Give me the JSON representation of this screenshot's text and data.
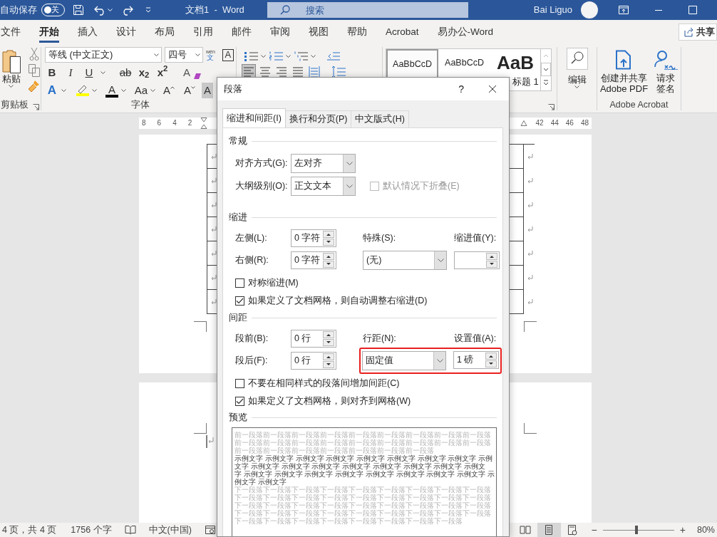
{
  "title_bar": {
    "autosave_label": "自动保存",
    "autosave_toggle": {
      "label": "关",
      "on": false
    },
    "document_title": "文档1  -  Word",
    "search": {
      "placeholder": "搜索"
    },
    "user_name": "Bai Liguo"
  },
  "ribbon_tabs": [
    {
      "label": "文件",
      "selected": false
    },
    {
      "label": "开始",
      "selected": true
    },
    {
      "label": "插入",
      "selected": false
    },
    {
      "label": "设计",
      "selected": false
    },
    {
      "label": "布局",
      "selected": false
    },
    {
      "label": "引用",
      "selected": false
    },
    {
      "label": "邮件",
      "selected": false
    },
    {
      "label": "审阅",
      "selected": false
    },
    {
      "label": "视图",
      "selected": false
    },
    {
      "label": "帮助",
      "selected": false
    },
    {
      "label": "Acrobat",
      "selected": false
    },
    {
      "label": "易办公-Word",
      "selected": false
    }
  ],
  "share_button": {
    "label": "共享"
  },
  "clipboard": {
    "paste_label": "粘贴",
    "group_label": "剪贴板"
  },
  "font": {
    "font_name": "等线 (中文正文)",
    "font_size": "四号",
    "phonetic": {
      "top": "wén",
      "bottom": "文"
    },
    "border_label": "A",
    "row2": [
      {
        "kind": "bold",
        "label": "B"
      },
      {
        "kind": "italic",
        "label": "I"
      },
      {
        "kind": "underline",
        "label": "U"
      },
      {
        "kind": "strike",
        "label": "ab"
      },
      {
        "kind": "subscript",
        "label": "x$_{2}$"
      },
      {
        "kind": "superscript",
        "label": "x$^{2}$"
      },
      {
        "kind": "clear",
        "label": "A"
      }
    ],
    "row3": [
      {
        "kind": "effects",
        "label": "A"
      },
      {
        "kind": "highlight",
        "color": "#ffff00"
      },
      {
        "kind": "color",
        "label": "A",
        "color": "#000000"
      },
      {
        "kind": "case",
        "label": "Aa"
      },
      {
        "kind": "grow",
        "label": "A"
      },
      {
        "kind": "shrink",
        "label": "A"
      },
      {
        "kind": "shading",
        "label": "A"
      }
    ],
    "group_label": "字体"
  },
  "paragraph": {
    "alignment": [
      {
        "kind": "left",
        "selected": true
      },
      {
        "kind": "center",
        "selected": false
      },
      {
        "kind": "right",
        "selected": false
      },
      {
        "kind": "justify",
        "selected": false
      },
      {
        "kind": "distributed",
        "selected": false
      }
    ]
  },
  "styles": [
    {
      "kind": "normal",
      "preview": "AaBbCcD",
      "selected": true
    },
    {
      "kind": "nospacing",
      "preview": "AaBbCcD",
      "selected": false
    },
    {
      "kind": "heading",
      "preview": "AaB",
      "label": "标题 1",
      "selected": false
    }
  ],
  "editing": {
    "label": "编辑"
  },
  "acrobat": {
    "buttons": [
      {
        "kind": "pdf",
        "lines": [
          "创建并共享",
          "Adobe PDF"
        ]
      },
      {
        "kind": "sign",
        "lines": [
          "请求",
          "签名"
        ]
      }
    ],
    "group_label": "Adobe Acrobat"
  },
  "ruler": {
    "left_numbers": [
      "8",
      "6",
      "4",
      "2"
    ],
    "right_numbers": [
      "42",
      "44",
      "46",
      "48"
    ]
  },
  "document": {
    "table_rows": [
      {
        "paragraph_mark": true
      },
      {
        "paragraph_mark": true
      },
      {
        "paragraph_mark": true
      },
      {
        "paragraph_mark": true
      },
      {
        "paragraph_mark": true
      },
      {
        "paragraph_mark": true
      },
      {
        "paragraph_mark": true
      }
    ]
  },
  "dialog": {
    "title": "段落",
    "help": "?",
    "tabs": [
      {
        "label": "缩进和间距(I)",
        "selected": true
      },
      {
        "label": "换行和分页(P)",
        "selected": false
      },
      {
        "label": "中文版式(H)",
        "selected": false
      }
    ],
    "general": {
      "heading": "常规",
      "alignment": {
        "label": "对齐方式(G):",
        "value": "左对齐"
      },
      "outline_level": {
        "label": "大纲级别(O):",
        "value": "正文文本"
      },
      "collapse": {
        "label": "默认情况下折叠(E)",
        "checked": false,
        "disabled": true
      }
    },
    "indent": {
      "heading": "缩进",
      "left": {
        "label": "左侧(L):",
        "value": "0 字符"
      },
      "right": {
        "label": "右侧(R):",
        "value": "0 字符"
      },
      "special": {
        "label": "特殊(S):",
        "value": "(无)"
      },
      "by": {
        "label": "缩进值(Y):"
      },
      "options": [
        {
          "label": "对称缩进(M)",
          "checked": false
        },
        {
          "label": "如果定义了文档网格，则自动调整右缩进(D)",
          "checked": true
        }
      ]
    },
    "spacing": {
      "heading": "间距",
      "before": {
        "label": "段前(B):",
        "value": "0 行"
      },
      "after": {
        "label": "段后(F):",
        "value": "0 行"
      },
      "line_spacing": {
        "label": "行距(N):",
        "value": "固定值"
      },
      "at": {
        "label": "设置值(A):",
        "value": "1 磅"
      },
      "highlighted": true,
      "options": [
        {
          "label": "不要在相同样式的段落间增加间距(C)",
          "checked": false
        },
        {
          "label": "如果定义了文档网格，则对齐到网格(W)",
          "checked": true
        }
      ]
    },
    "preview": {
      "heading": "预览",
      "previous_text": "前一段落前一段落前一段落前一段落前一段落前一段落前一段落前一段落前一段落前一段落前一段落前一段落前一段落前一段落前一段落前一段落前一段落前一段落前一段落前一段落前一段落前一段落前一段落前一段落前一段落",
      "sample_text": "示例文字 示例文字 示例文字 示例文字 示例文字 示例文字 示例文字 示例文字 示例文字 示例文字 示例文字 示例文字 示例文字 示例文字 示例文字 示例文字 示例文字 示例文字 示例文字 示例文字 示例文字 示例文字 示例文字 示例文字 示例文字 示例文字 示例文字",
      "next_text": "下一段落下一段落下一段落下一段落下一段落下一段落下一段落下一段落下一段落下一段落下一段落下一段落下一段落下一段落下一段落下一段落下一段落下一段落下一段落下一段落下一段落下一段落下一段落下一段落下一段落下一段落下一段落下一段落下一段落下一段落下一段落下一段落下一段落下一段落下一段落下一段落下一段落下一段落下一段落下一段落下一段落下一段落下一段落下一段落"
    }
  },
  "status_bar": {
    "page": "4 页，共 4 页",
    "words": "1756 个字",
    "language": "中文(中国)",
    "views": [
      {
        "kind": "read",
        "selected": false
      },
      {
        "kind": "print",
        "selected": true
      },
      {
        "kind": "web",
        "selected": false
      }
    ],
    "zoom_out": "−",
    "zoom_in": "+",
    "zoom": {
      "level": 0.47,
      "reading": "80%"
    }
  }
}
